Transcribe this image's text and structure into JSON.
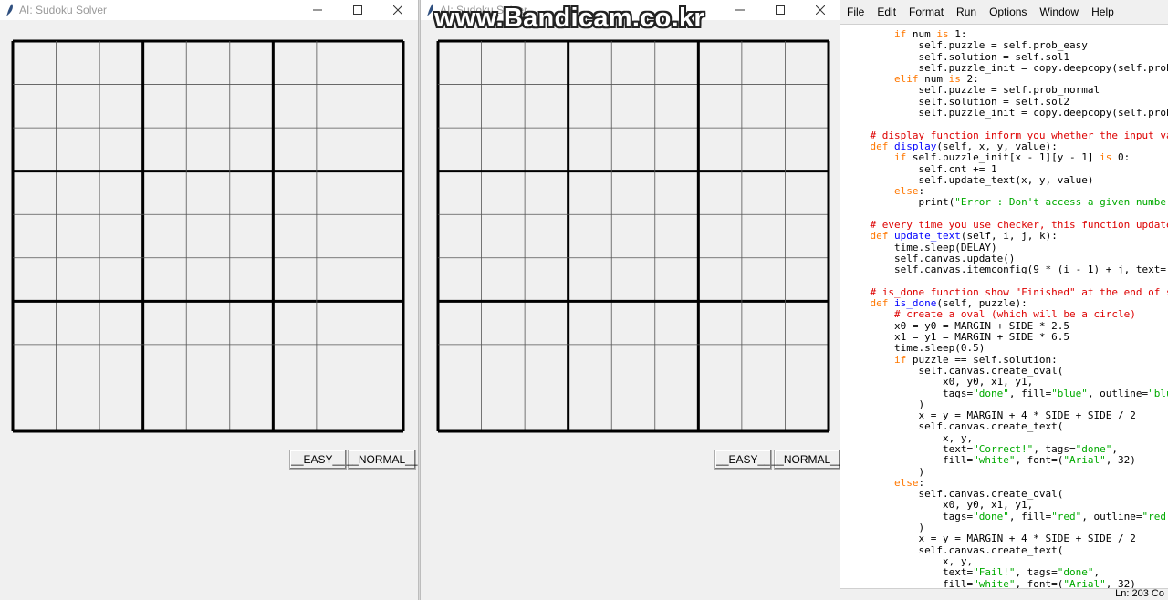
{
  "window1": {
    "title": "AI: Sudoku Solver",
    "buttons": {
      "easy": "__EASY__",
      "normal": "__NORMAL__"
    }
  },
  "window2": {
    "title": "AI: Sudoku Solver",
    "buttons": {
      "easy": "__EASY__",
      "normal": "__NORMAL__"
    }
  },
  "watermark": "www.Bandicam.co.kr",
  "editor": {
    "menu": [
      "File",
      "Edit",
      "Format",
      "Run",
      "Options",
      "Window",
      "Help"
    ],
    "code_lines": [
      "        if num is 1:",
      "            self.puzzle = self.prob_easy",
      "            self.solution = self.sol1",
      "            self.puzzle_init = copy.deepcopy(self.prob",
      "        elif num is 2:",
      "            self.puzzle = self.prob_normal",
      "            self.solution = self.sol2",
      "            self.puzzle_init = copy.deepcopy(self.prob",
      "",
      "    # display function inform you whether the input va",
      "    def display(self, x, y, value):",
      "        if self.puzzle_init[x - 1][y - 1] is 0:",
      "            self.cnt += 1",
      "            self.update_text(x, y, value)",
      "        else:",
      "            print(\"Error : Don't access a given numbe",
      "",
      "    # every time you use checker, this function update",
      "    def update_text(self, i, j, k):",
      "        time.sleep(DELAY)",
      "        self.canvas.update()",
      "        self.canvas.itemconfig(9 * (i - 1) + j, text=",
      "",
      "    # is_done function show \"Finished\" at the end of s",
      "    def is_done(self, puzzle):",
      "        # create a oval (which will be a circle)",
      "        x0 = y0 = MARGIN + SIDE * 2.5",
      "        x1 = y1 = MARGIN + SIDE * 6.5",
      "        time.sleep(0.5)",
      "        if puzzle == self.solution:",
      "            self.canvas.create_oval(",
      "                x0, y0, x1, y1,",
      "                tags=\"done\", fill=\"blue\", outline=\"blu",
      "            )",
      "            x = y = MARGIN + 4 * SIDE + SIDE / 2",
      "            self.canvas.create_text(",
      "                x, y,",
      "                text=\"Correct!\", tags=\"done\",",
      "                fill=\"white\", font=(\"Arial\", 32)",
      "            )",
      "        else:",
      "            self.canvas.create_oval(",
      "                x0, y0, x1, y1,",
      "                tags=\"done\", fill=\"red\", outline=\"red",
      "            )",
      "            x = y = MARGIN + 4 * SIDE + SIDE / 2",
      "            self.canvas.create_text(",
      "                x, y,",
      "                text=\"Fail!\", tags=\"done\",",
      "                fill=\"white\", font=(\"Arial\", 32)"
    ],
    "status": "Ln: 203  Co"
  }
}
